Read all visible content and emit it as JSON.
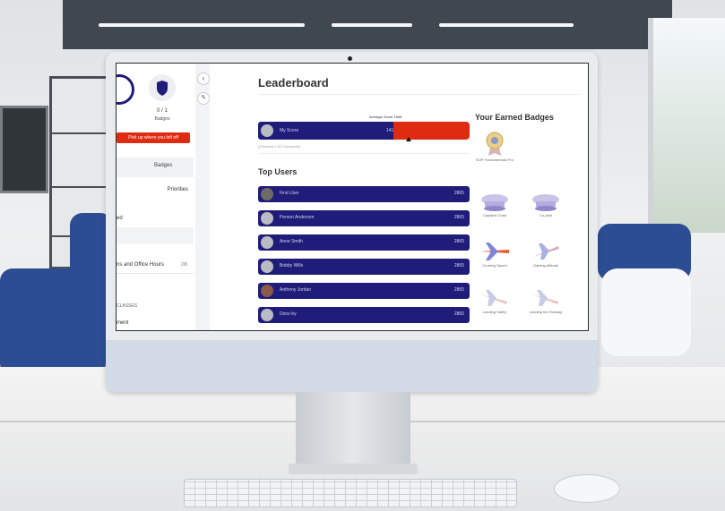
{
  "sidebar": {
    "stat_value": "0 / 1",
    "stat_label": "Badges",
    "resume_button": "Pick up where you left off",
    "tab_badges": "Badges",
    "row_priorities": "Priorities",
    "row_completed": "ed",
    "row_sessions": "ns and Office Hours",
    "row_sessions_count": "2/8",
    "classes_heading": "CLASSES",
    "row_enrollment": "ment"
  },
  "main": {
    "title": "Leaderboard",
    "average_label": "Average Score 1848",
    "my_bar": {
      "name": "My Score",
      "score": "1418"
    },
    "my_bar_note": "(Checked 4,517 Accounts)",
    "top_users_title": "Top Users",
    "top_users": [
      {
        "name": "First User",
        "score": "2865"
      },
      {
        "name": "Person Anderson",
        "score": "2865"
      },
      {
        "name": "Anne Smith",
        "score": "2865"
      },
      {
        "name": "Bobby Wills",
        "score": "2865"
      },
      {
        "name": "Anthony Jordan",
        "score": "2865"
      },
      {
        "name": "Dora Ivy",
        "score": "2865"
      }
    ]
  },
  "badges": {
    "title": "Your Earned Badges",
    "items": [
      {
        "label": "SOP Fundamentals Pro",
        "icon": "medal-icon"
      },
      {
        "label": "Captains Chair",
        "icon": "captain-hat-icon"
      },
      {
        "label": "Co-pilot",
        "icon": "pilot-hat-icon"
      },
      {
        "label": "Cruising Speed",
        "icon": "airplane-icon"
      },
      {
        "label": "Gaining Altitude",
        "icon": "airplane-icon"
      },
      {
        "label": "Landing Safely",
        "icon": "airplane-landing-icon"
      },
      {
        "label": "Landing the Runway",
        "icon": "airplane-landing-icon"
      }
    ]
  },
  "colors": {
    "bar": "#1f1c7a",
    "accent": "#e02b13"
  }
}
